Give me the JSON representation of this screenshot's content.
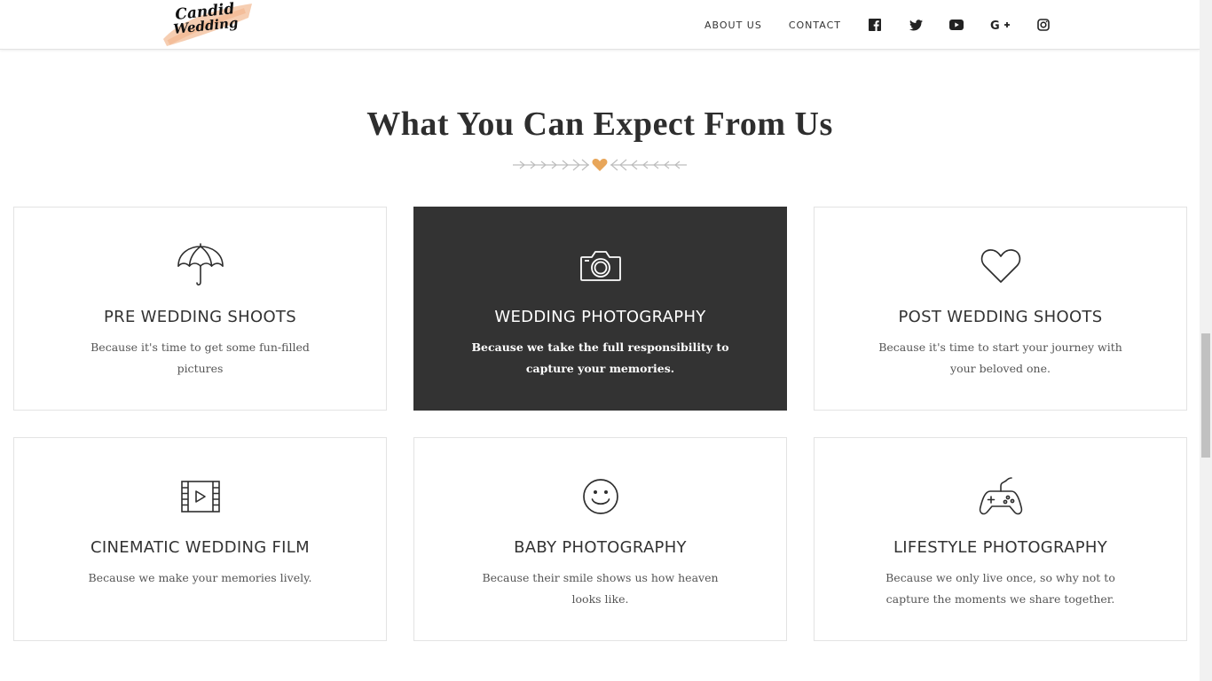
{
  "header": {
    "logo_text": "Candid Wedding",
    "nav": [
      {
        "label": "ABOUT US"
      },
      {
        "label": "CONTACT"
      }
    ],
    "social_icons": [
      "facebook-icon",
      "twitter-icon",
      "youtube-icon",
      "google-plus-icon",
      "instagram-icon"
    ]
  },
  "section": {
    "title": "What You Can Expect From Us"
  },
  "services": [
    {
      "icon": "umbrella-icon",
      "title": "PRE WEDDING SHOOTS",
      "text": "Because it's time to get some fun-filled pictures"
    },
    {
      "icon": "camera-icon",
      "title": "WEDDING PHOTOGRAPHY",
      "text": "Because we take the full responsibility to capture your memories."
    },
    {
      "icon": "heart-icon",
      "title": "POST WEDDING SHOOTS",
      "text": "Because it's time to start your journey with your beloved one."
    },
    {
      "icon": "film-icon",
      "title": "CINEMATIC WEDDING FILM",
      "text": "Because we make your memories lively."
    },
    {
      "icon": "smiley-icon",
      "title": "BABY PHOTOGRAPHY",
      "text": "Because their smile shows us how heaven looks like."
    },
    {
      "icon": "gamepad-icon",
      "title": "LIFESTYLE PHOTOGRAPHY",
      "text": "Because we only live once, so why not to capture the moments we share together."
    }
  ],
  "colors": {
    "accent": "#e8a65a",
    "dark_card": "#333333",
    "logo_brush": "#f5c6a5"
  }
}
